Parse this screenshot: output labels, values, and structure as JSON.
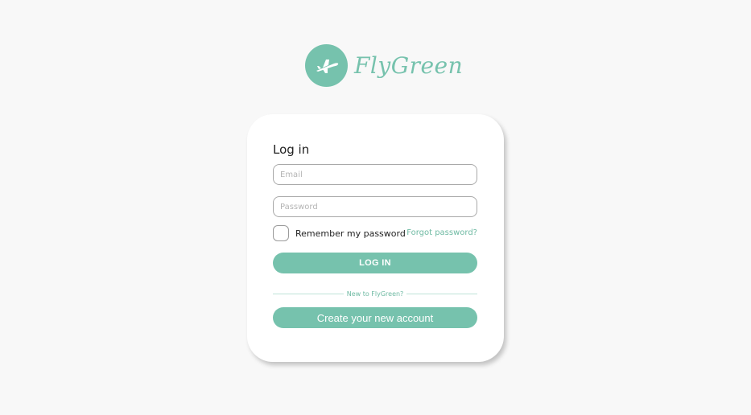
{
  "brand": {
    "name": "FlyGreen",
    "color": "#76c2ad",
    "logo_icon": "airplane-icon"
  },
  "login": {
    "title": "Log in",
    "email_placeholder": "Email",
    "password_placeholder": "Password",
    "remember_label": "Remember my password",
    "forgot_link": "Forgot password?",
    "login_button": "LOG IN",
    "divider_text": "New to FlyGreen?",
    "create_button": "Create your new account"
  },
  "colors": {
    "accent": "#76c2ad",
    "background": "#f8f8f8",
    "card": "#ffffff"
  }
}
